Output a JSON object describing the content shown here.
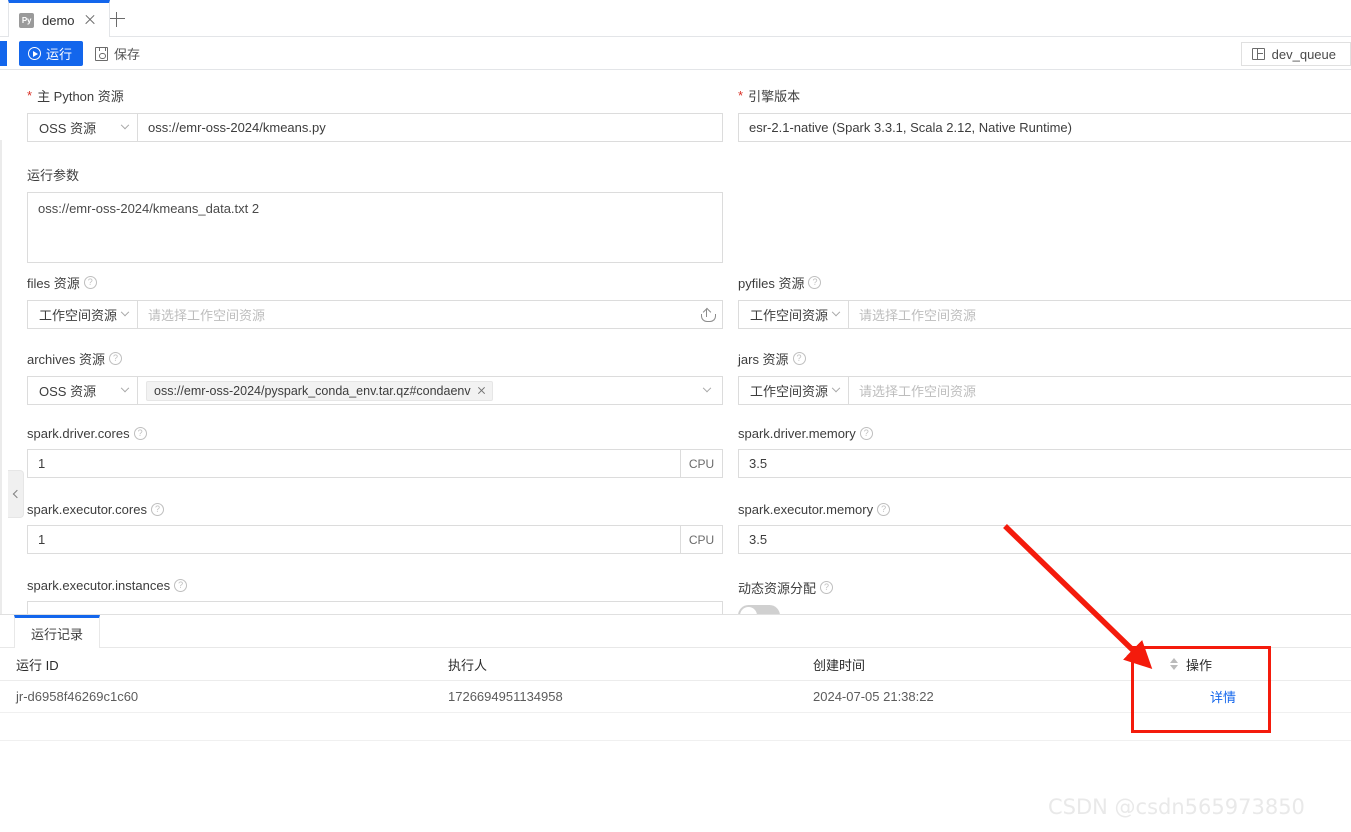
{
  "tabbar": {
    "tab_label": "demo",
    "tab_icon": "python-file-icon",
    "close_icon": "close-icon",
    "add_icon": "plus-icon"
  },
  "toolbar": {
    "run_label": "运行",
    "run_icon": "play-circle-icon",
    "save_label": "保存",
    "save_icon": "save-disk-icon",
    "queue_label": "dev_queue",
    "queue_icon": "queue-grid-icon",
    "accent_color": "#1366ec"
  },
  "form": {
    "collapse_icon": "chevron-left-icon",
    "main_python": {
      "label": "主 Python 资源",
      "required_mark": "*",
      "source_select": "OSS 资源",
      "value": "oss://emr-oss-2024/kmeans.py"
    },
    "engine_version": {
      "label": "引擎版本",
      "required_mark": "*",
      "value": "esr-2.1-native (Spark 3.3.1, Scala 2.12, Native Runtime)"
    },
    "run_params": {
      "label": "运行参数",
      "value": "oss://emr-oss-2024/kmeans_data.txt 2"
    },
    "files_res": {
      "label": "files 资源",
      "help_icon": "question-circle-icon",
      "source_select": "工作空间资源",
      "placeholder": "请选择工作空间资源",
      "upload_icon": "upload-cloud-icon"
    },
    "pyfiles_res": {
      "label": "pyfiles 资源",
      "help_icon": "question-circle-icon",
      "source_select": "工作空间资源",
      "placeholder": "请选择工作空间资源"
    },
    "archives_res": {
      "label": "archives 资源",
      "help_icon": "question-circle-icon",
      "source_select": "OSS 资源",
      "tag_value": "oss://emr-oss-2024/pyspark_conda_env.tar.qz#condaenv",
      "tag_close_icon": "close-icon",
      "dropdown_icon": "chevron-down-icon"
    },
    "jars_res": {
      "label": "jars 资源",
      "help_icon": "question-circle-icon",
      "source_select": "工作空间资源",
      "placeholder": "请选择工作空间资源"
    },
    "driver_cores": {
      "label": "spark.driver.cores",
      "help_icon": "question-circle-icon",
      "value": "1",
      "unit": "CPU"
    },
    "driver_memory": {
      "label": "spark.driver.memory",
      "help_icon": "question-circle-icon",
      "value": "3.5"
    },
    "executor_cores": {
      "label": "spark.executor.cores",
      "help_icon": "question-circle-icon",
      "value": "1",
      "unit": "CPU"
    },
    "executor_memory": {
      "label": "spark.executor.memory",
      "help_icon": "question-circle-icon",
      "value": "3.5"
    },
    "executor_instances": {
      "label": "spark.executor.instances",
      "help_icon": "question-circle-icon"
    },
    "dynamic_alloc": {
      "label": "动态资源分配",
      "help_icon": "question-circle-icon",
      "toggle_state": "off"
    }
  },
  "bottom": {
    "tab_label": "运行记录",
    "table": {
      "headers": [
        "运行 ID",
        "执行人",
        "创建时间",
        "操作"
      ],
      "sort_icon": "sort-updown-icon",
      "rows": [
        {
          "run_id": "jr-d6958f46269c1c60",
          "operator": "1726694951134958",
          "created_at": "2024-07-05 21:38:22",
          "action": "详情"
        }
      ]
    }
  },
  "annotations": {
    "arrow_color": "#f41b0c",
    "highlight_box_color": "#f41b0c",
    "watermark": "CSDN @csdn565973850"
  }
}
